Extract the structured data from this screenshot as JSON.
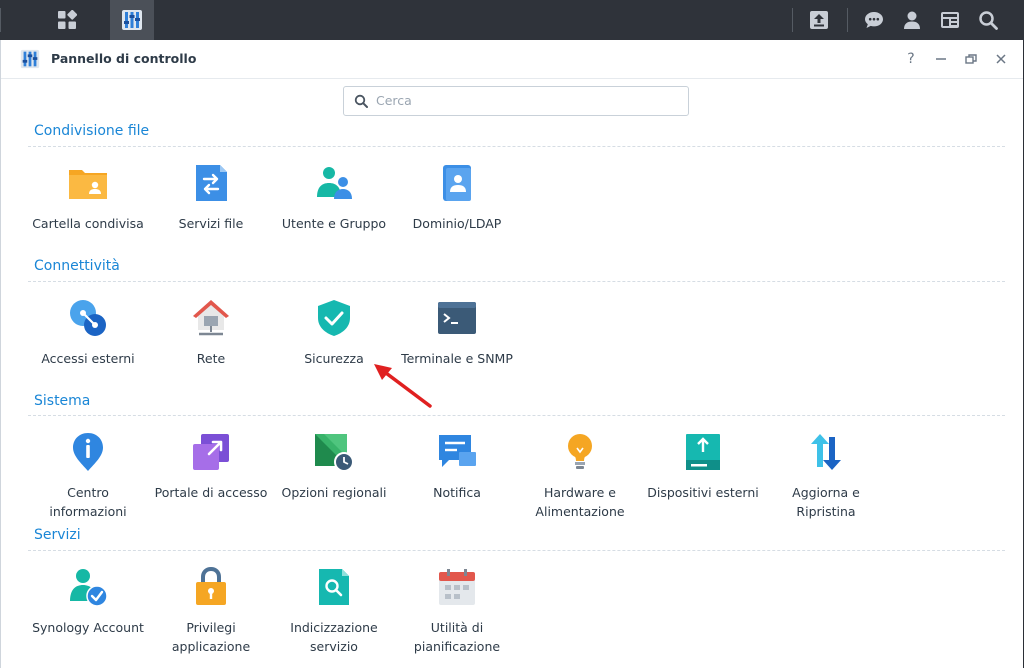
{
  "window": {
    "title": "Pannello di controllo"
  },
  "search": {
    "placeholder": "Cerca"
  },
  "sections": [
    {
      "title": "Condivisione file",
      "items": [
        {
          "label": "Cartella condivisa",
          "icon": "shared-folder-icon"
        },
        {
          "label": "Servizi file",
          "icon": "file-services-icon"
        },
        {
          "label": "Utente e Gruppo",
          "icon": "user-group-icon"
        },
        {
          "label": "Dominio/LDAP",
          "icon": "domain-ldap-icon"
        }
      ]
    },
    {
      "title": "Connettività",
      "items": [
        {
          "label": "Accessi esterni",
          "icon": "external-access-icon"
        },
        {
          "label": "Rete",
          "icon": "network-icon"
        },
        {
          "label": "Sicurezza",
          "icon": "security-shield-icon"
        },
        {
          "label": "Terminale e SNMP",
          "icon": "terminal-icon"
        }
      ]
    },
    {
      "title": "Sistema",
      "items": [
        {
          "label": "Centro informazioni",
          "icon": "info-center-icon"
        },
        {
          "label": "Portale di accesso",
          "icon": "login-portal-icon"
        },
        {
          "label": "Opzioni regionali",
          "icon": "regional-options-icon"
        },
        {
          "label": "Notifica",
          "icon": "notification-icon"
        },
        {
          "label": "Hardware e Alimentazione",
          "icon": "hardware-power-icon"
        },
        {
          "label": "Dispositivi esterni",
          "icon": "external-devices-icon"
        },
        {
          "label": "Aggiorna e Ripristina",
          "icon": "update-restore-icon"
        }
      ]
    },
    {
      "title": "Servizi",
      "items": [
        {
          "label": "Synology Account",
          "icon": "synology-account-icon"
        },
        {
          "label": "Privilegi applicazione",
          "icon": "app-privileges-icon"
        },
        {
          "label": "Indicizzazione servizio",
          "icon": "indexing-service-icon"
        },
        {
          "label": "Utilità di pianificazione",
          "icon": "task-scheduler-icon"
        }
      ]
    }
  ],
  "annotation": {
    "icon": "red-arrow-icon",
    "color": "#e02020"
  },
  "colors": {
    "accent": "#1a86d6",
    "taskbar": "#2f333a"
  }
}
